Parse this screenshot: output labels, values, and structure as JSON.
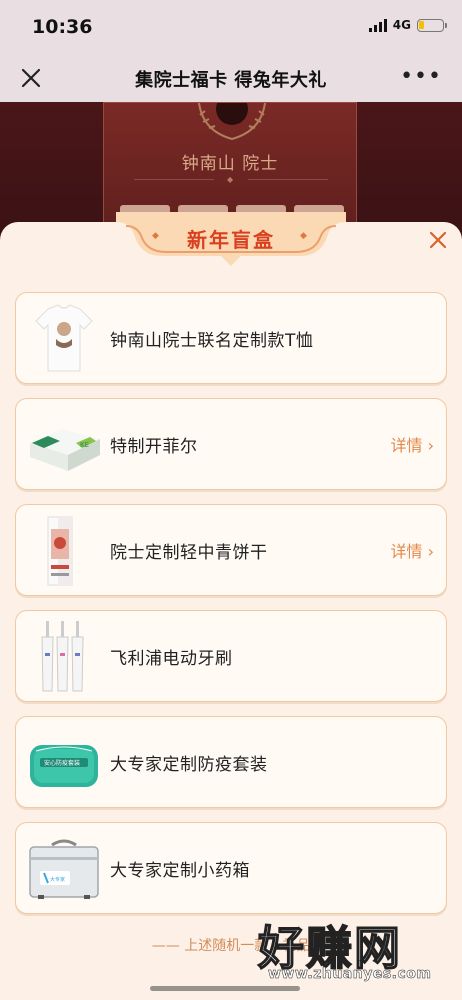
{
  "status_bar": {
    "time": "10:36",
    "network": "4G",
    "battery_level": 0.2,
    "battery_color": "#f2c200"
  },
  "nav": {
    "title": "集院士福卡 得兔年大礼",
    "close_icon": "close-icon",
    "more_icon": "more-icon"
  },
  "background": {
    "name": "钟南山 院士"
  },
  "modal": {
    "title": "新年盲盒",
    "close_icon": "close-icon",
    "items": [
      {
        "name": "钟南山院士联名定制款T恤",
        "detail": "",
        "icon": "tshirt-icon"
      },
      {
        "name": "特制开菲尔",
        "detail": "详情",
        "icon": "kefir-box-icon"
      },
      {
        "name": "院士定制轻中青饼干",
        "detail": "详情",
        "icon": "biscuit-box-icon"
      },
      {
        "name": "飞利浦电动牙刷",
        "detail": "",
        "icon": "toothbrush-icon"
      },
      {
        "name": "大专家定制防疫套装",
        "detail": "",
        "icon": "pouch-icon"
      },
      {
        "name": "大专家定制小药箱",
        "detail": "",
        "icon": "medicine-box-icon"
      }
    ],
    "footer_note": "—— 上述随机一款，礼品"
  },
  "watermark": {
    "logo": "好赚网",
    "url": "www.zhuanyes.com"
  },
  "colors": {
    "accent": "#d9401f",
    "detail": "#e3894a",
    "modal_bg": "#fdf0e6",
    "item_border": "#f0c9a2"
  }
}
